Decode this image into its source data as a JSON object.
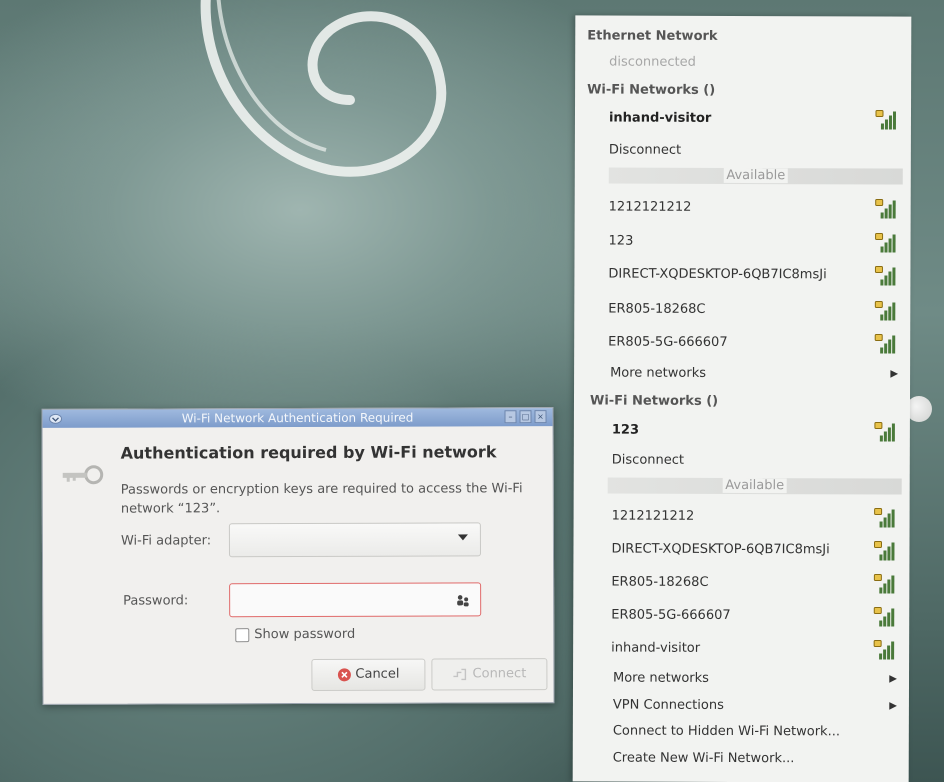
{
  "network_menu": {
    "ethernet_header": "Ethernet Network",
    "ethernet_status": "disconnected",
    "wifi_group_1": {
      "header": "Wi-Fi Networks ()",
      "connected": "inhand-visitor",
      "disconnect": "Disconnect",
      "available_label": "Available",
      "networks": [
        "1212121212",
        "123",
        "DIRECT-XQDESKTOP-6QB7IC8msJi",
        "ER805-18268C",
        "ER805-5G-666607"
      ],
      "more": "More networks"
    },
    "wifi_group_2": {
      "header": "Wi-Fi Networks ()",
      "connected": "123",
      "disconnect": "Disconnect",
      "available_label": "Available",
      "networks": [
        "1212121212",
        "DIRECT-XQDESKTOP-6QB7IC8msJi",
        "ER805-18268C",
        "ER805-5G-666607",
        "inhand-visitor"
      ],
      "more": "More networks"
    },
    "vpn": "VPN Connections",
    "connect_hidden": "Connect to Hidden Wi-Fi Network...",
    "create_new": "Create New Wi-Fi Network..."
  },
  "dialog": {
    "title": "Wi-Fi Network Authentication Required",
    "heading": "Authentication required by Wi-Fi network",
    "message": "Passwords or encryption keys are required to access the Wi-Fi network “123”.",
    "adapter_label": "Wi-Fi adapter:",
    "adapter_value": "",
    "password_label": "Password:",
    "password_value": "",
    "show_password_label": "Show password",
    "show_password_checked": false,
    "cancel_label": "Cancel",
    "connect_label": "Connect"
  },
  "icons": {
    "signal": "wifi-signal-locked-icon",
    "submenu": "chevron-right-icon",
    "key": "key-icon",
    "people": "people-icon"
  },
  "colors": {
    "accent_titlebar": "#7d9ccb",
    "error_border": "#e06a6a",
    "cancel_red": "#d9534f",
    "signal_green": "#4a7a3a"
  }
}
